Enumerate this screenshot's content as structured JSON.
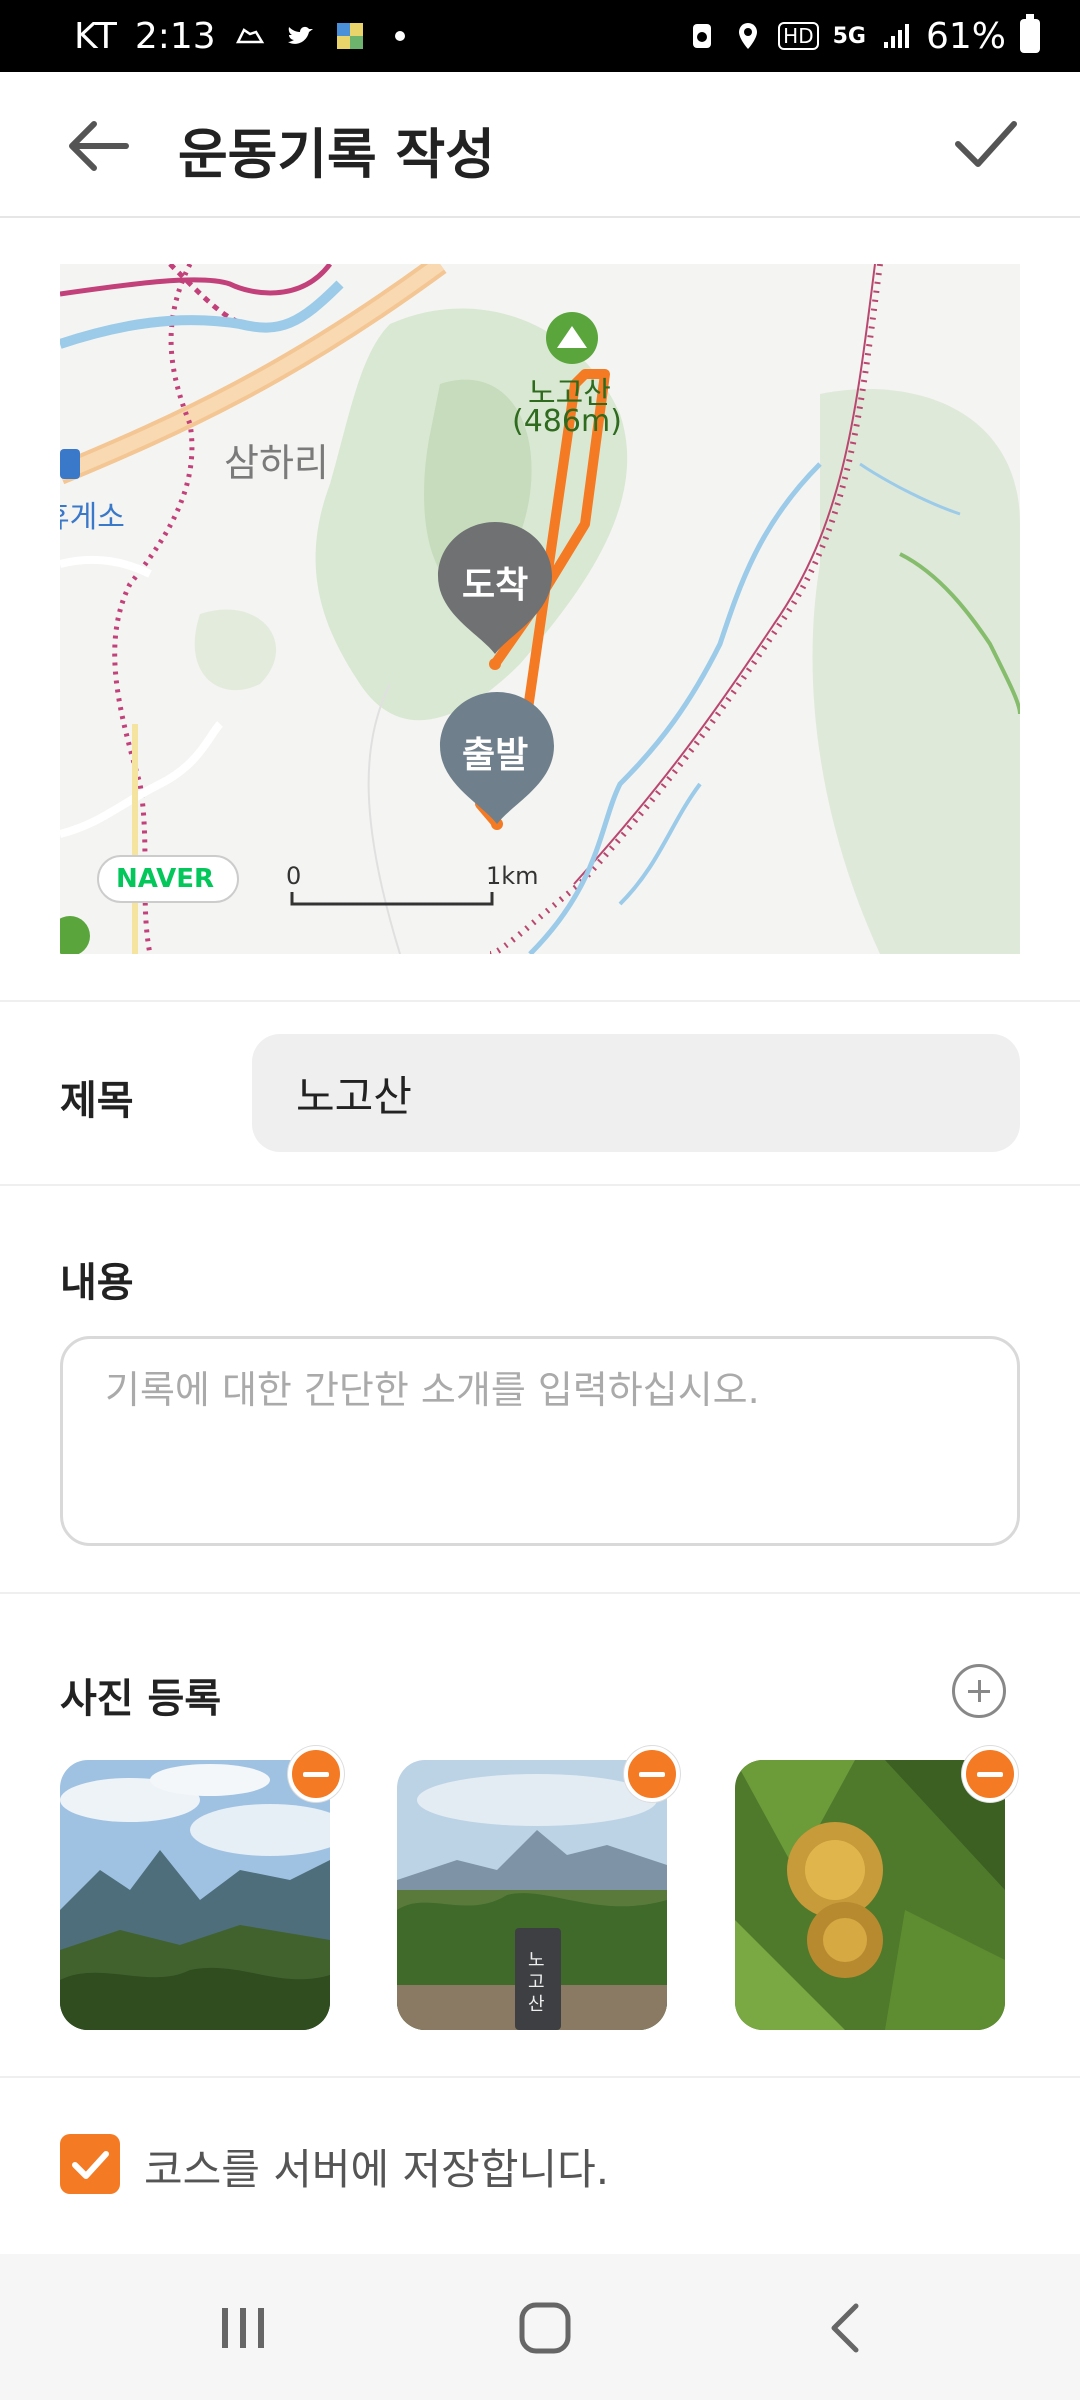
{
  "status_bar": {
    "carrier": "KT",
    "time": "2:13",
    "network_badge_hd": "HD",
    "network_badge_5g": "5G",
    "battery": "61%"
  },
  "app_bar": {
    "title": "운동기록 작성",
    "back_icon": "arrow-left-icon",
    "done_icon": "checkmark-icon"
  },
  "map": {
    "peak_label": "노고산",
    "peak_elevation": "(486m)",
    "village_label": "삼하리",
    "rest_area_label": "휴게소",
    "arrival_marker": "도착",
    "start_marker": "출발",
    "provider": "NAVER",
    "scale_start": "0",
    "scale_end": "1km",
    "route_color": "#f47a24"
  },
  "form": {
    "title_label": "제목",
    "title_value": "노고산",
    "content_label": "내용",
    "content_placeholder": "기록에 대한 간단한 소개를 입력하십시오.",
    "photos_label": "사진 등록",
    "photos": [
      {
        "alt": "mountain-ridge-photo"
      },
      {
        "alt": "summit-marker-photo",
        "sign_text": "노고산"
      },
      {
        "alt": "chestnut-burr-photo"
      }
    ],
    "save_course_label": "코스를 서버에 저장합니다.",
    "save_course_checked": true
  },
  "accent_color": "#f47a24"
}
